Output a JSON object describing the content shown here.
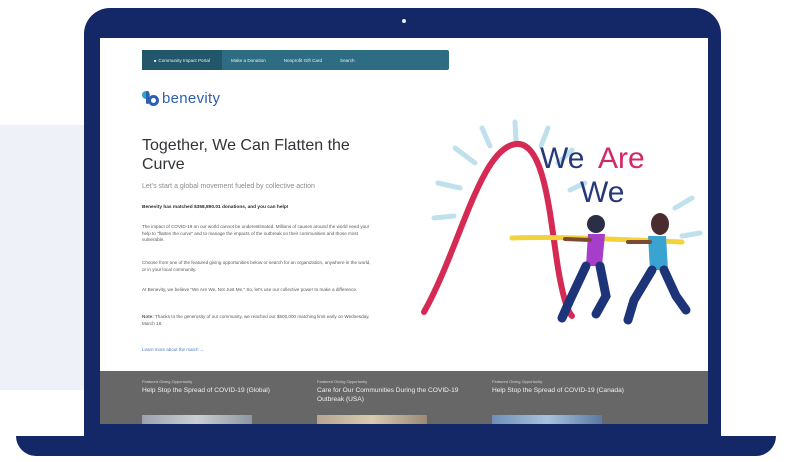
{
  "screen": {
    "nav": {
      "items": [
        {
          "label": "Community Impact Portal"
        },
        {
          "label": "Make a Donation"
        },
        {
          "label": "Nonprofit Gift Card"
        },
        {
          "label": "Search"
        }
      ]
    },
    "logo": {
      "text": "benevity"
    },
    "hero": {
      "title": "Together, We Can Flatten the Curve",
      "subtitle": "Let's start a global movement fueled by collective action",
      "stat_line": "Benevity has matched $358,890.01 donations, and you can help!",
      "paragraphs": [
        "The impact of COVID-19 on our world cannot be underestimated. Millions of causes around the world need your help to \"flatten the curve\" and to manage the impacts of the outbreak on their communities and those most vulnerable.",
        "Choose from one of the featured giving opportunities below or search for an organization, anywhere in the world, or in your local community.",
        "At Benevity, we believe \"We Are We, Not Just Me.\" So, let's use our collective power to make a difference.",
        "Thanks to the generosity of our community, we reached our $500,000 matching limit early on Wednesday, March 18."
      ],
      "note_label": "Note:",
      "learn_more": "Learn more about the match →"
    },
    "artwork": {
      "line1": "We",
      "line2": "Are",
      "line3": "We",
      "colors": {
        "we": "#263a7a",
        "are": "#d2276a",
        "curve": "#d42a54",
        "rope": "#f2d33b"
      }
    },
    "cards": [
      {
        "label": "Featured Giving Opportunity",
        "title": "Help Stop the Spread of COVID-19 (Global)"
      },
      {
        "label": "Featured Giving Opportunity",
        "title": "Care for Our Communities During the COVID-19 Outbreak (USA)"
      },
      {
        "label": "Featured Giving Opportunity",
        "title": "Help Stop the Spread of COVID-19 (Canada)"
      }
    ]
  }
}
